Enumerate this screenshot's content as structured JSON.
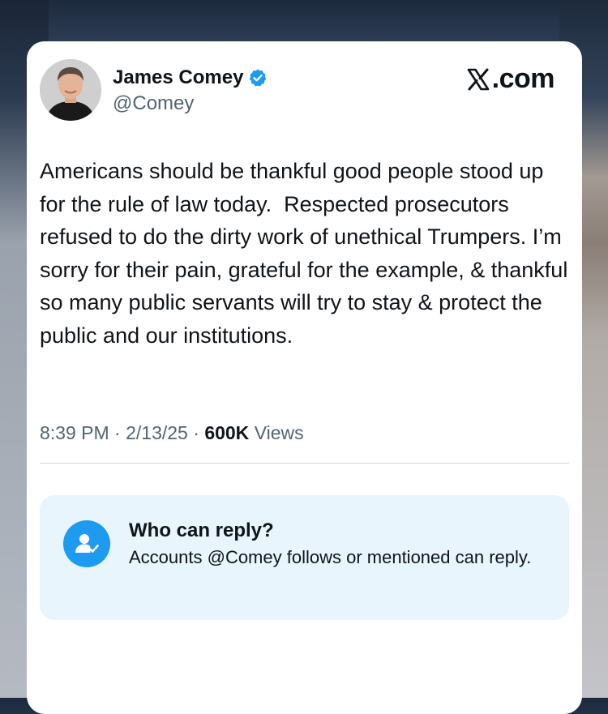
{
  "post": {
    "author_name": "James Comey",
    "author_handle": "@Comey",
    "verified": true,
    "brand": ".com",
    "brand_icon": "x-logo-icon",
    "text": "Americans should be thankful good people stood up for the rule of law today.  Respected prosecutors refused to do the dirty work of unethical Trumpers. I’m sorry for their pain, grateful for the example, & thankful so many public servants will try to stay & protect the public and our institutions.",
    "time": "8:39 PM",
    "separator": "·",
    "date": "2/13/25",
    "views_count": "600K",
    "views_label": "Views"
  },
  "reply_settings": {
    "icon": "mentioned-user-icon",
    "title": "Who can reply?",
    "description": "Accounts @Comey follows or mentioned can reply."
  },
  "colors": {
    "accent": "#1d9bf0",
    "text_primary": "#0f1419",
    "text_secondary": "#536471",
    "reply_box_bg": "#e8f5fd"
  }
}
